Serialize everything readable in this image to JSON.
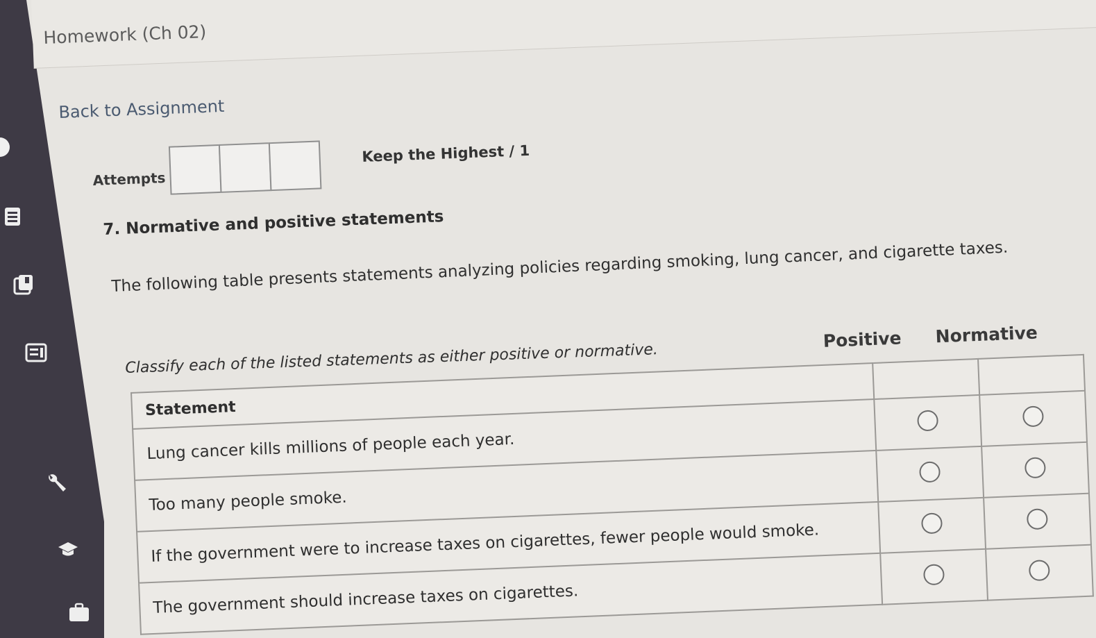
{
  "page": {
    "title": "Homework (Ch 02)",
    "back_link": "Back to Assignment"
  },
  "attempts": {
    "label": "Attempts",
    "boxes": 3,
    "grading_label": "Keep the Highest / 1"
  },
  "question": {
    "title": "7. Normative and positive statements",
    "intro": "The following table presents statements analyzing policies regarding smoking, lung cancer, and cigarette taxes.",
    "instructions": "Classify each of the listed statements as either positive or normative."
  },
  "table": {
    "statement_header": "Statement",
    "option_headers": [
      "Positive",
      "Normative"
    ],
    "rows": [
      {
        "statement": "Lung cancer kills millions of people each year.",
        "selected": null
      },
      {
        "statement": "Too many people smoke.",
        "selected": null
      },
      {
        "statement": "If the government were to increase taxes on cigarettes, fewer people would smoke.",
        "selected": null
      },
      {
        "statement": "The government should increase taxes on cigarettes.",
        "selected": null
      }
    ]
  },
  "sidebar": {
    "icons": [
      "partial-circle-icon",
      "list-icon",
      "book-icon",
      "panel-icon",
      "wrench-icon",
      "graduation-cap-icon",
      "briefcase-icon"
    ]
  },
  "colors": {
    "sidebar_bg": "#3e3a45",
    "page_bg": "#e7e5e1",
    "link": "#4a5a70"
  }
}
